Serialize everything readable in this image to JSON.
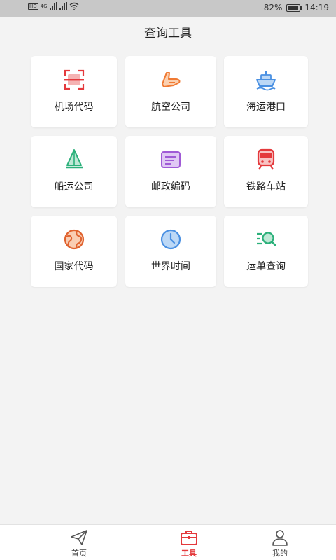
{
  "status_bar": {
    "battery": "82%",
    "time": "14:19",
    "network_left": "HD",
    "network_4g": "4G"
  },
  "page_title": "查询工具",
  "tools": [
    {
      "label": "机场代码",
      "icon": "airport-code-icon",
      "color": "#e4393c"
    },
    {
      "label": "航空公司",
      "icon": "airplane-icon",
      "color": "#f07a33"
    },
    {
      "label": "海运港口",
      "icon": "ship-icon",
      "color": "#4a90e2"
    },
    {
      "label": "船运公司",
      "icon": "sailboat-icon",
      "color": "#2bb07a"
    },
    {
      "label": "邮政编码",
      "icon": "postal-card-icon",
      "color": "#a05ad6"
    },
    {
      "label": "铁路车站",
      "icon": "train-icon",
      "color": "#e4393c"
    },
    {
      "label": "国家代码",
      "icon": "globe-icon",
      "color": "#e0622e"
    },
    {
      "label": "世界时间",
      "icon": "clock-icon",
      "color": "#4a90e2"
    },
    {
      "label": "运单查询",
      "icon": "search-list-icon",
      "color": "#2bb07a"
    }
  ],
  "tabs": [
    {
      "label": "首页",
      "icon": "send-icon",
      "active": false
    },
    {
      "label": "工具",
      "icon": "toolbox-icon",
      "active": true
    },
    {
      "label": "我的",
      "icon": "user-icon",
      "active": false
    }
  ],
  "colors": {
    "accent": "#e4393c",
    "background": "#f3f3f3"
  }
}
